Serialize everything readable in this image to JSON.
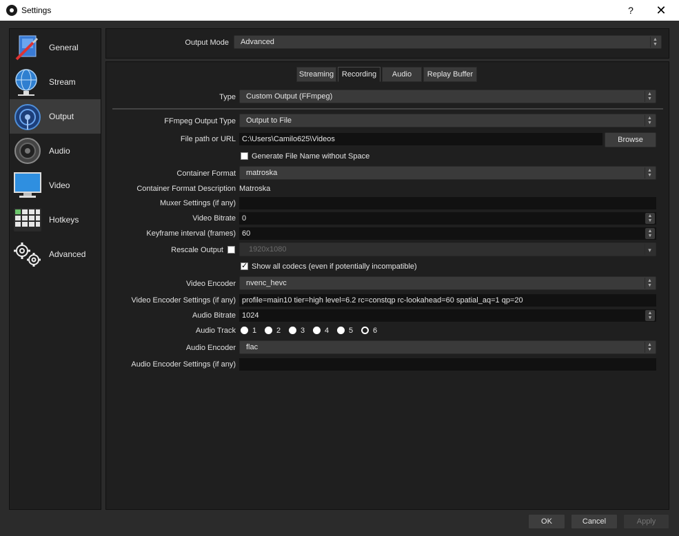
{
  "window": {
    "title": "Settings",
    "help_label": "?",
    "close_label": "✕"
  },
  "sidebar": {
    "items": [
      {
        "label": "General",
        "icon": "general-icon"
      },
      {
        "label": "Stream",
        "icon": "globe-icon"
      },
      {
        "label": "Output",
        "icon": "broadcast-icon"
      },
      {
        "label": "Audio",
        "icon": "speaker-icon"
      },
      {
        "label": "Video",
        "icon": "monitor-icon"
      },
      {
        "label": "Hotkeys",
        "icon": "keyboard-icon"
      },
      {
        "label": "Advanced",
        "icon": "gears-icon"
      }
    ],
    "active": "Output"
  },
  "output_mode": {
    "label": "Output Mode",
    "value": "Advanced"
  },
  "tabs": [
    {
      "label": "Streaming"
    },
    {
      "label": "Recording"
    },
    {
      "label": "Audio"
    },
    {
      "label": "Replay Buffer"
    }
  ],
  "active_tab": "Recording",
  "form": {
    "type": {
      "label": "Type",
      "value": "Custom Output (FFmpeg)"
    },
    "ffmpeg_output_type": {
      "label": "FFmpeg Output Type",
      "value": "Output to File"
    },
    "file_path": {
      "label": "File path or URL",
      "value": "C:\\Users\\Camilo625\\Videos",
      "browse_label": "Browse"
    },
    "gen_filename": {
      "label": "Generate File Name without Space",
      "checked": false
    },
    "container_format": {
      "label": "Container Format",
      "value": "matroska"
    },
    "container_desc": {
      "label": "Container Format Description",
      "value": "Matroska"
    },
    "muxer_settings": {
      "label": "Muxer Settings (if any)",
      "value": ""
    },
    "video_bitrate": {
      "label": "Video Bitrate",
      "value": "0"
    },
    "keyframe_interval": {
      "label": "Keyframe interval (frames)",
      "value": "60"
    },
    "rescale_output": {
      "label": "Rescale Output",
      "checked": false,
      "value": "1920x1080"
    },
    "show_all_codecs": {
      "label": "Show all codecs (even if potentially incompatible)",
      "checked": true
    },
    "video_encoder": {
      "label": "Video Encoder",
      "value": "nvenc_hevc"
    },
    "video_encoder_settings": {
      "label": "Video Encoder Settings (if any)",
      "value": "profile=main10 tier=high level=6.2 rc=constqp rc-lookahead=60 spatial_aq=1 qp=20"
    },
    "audio_bitrate": {
      "label": "Audio Bitrate",
      "value": "1024"
    },
    "audio_track": {
      "label": "Audio Track",
      "options": [
        "1",
        "2",
        "3",
        "4",
        "5",
        "6"
      ],
      "selected": "6"
    },
    "audio_encoder": {
      "label": "Audio Encoder",
      "value": "flac"
    },
    "audio_encoder_settings": {
      "label": "Audio Encoder Settings (if any)",
      "value": ""
    }
  },
  "footer": {
    "ok_label": "OK",
    "cancel_label": "Cancel",
    "apply_label": "Apply"
  }
}
